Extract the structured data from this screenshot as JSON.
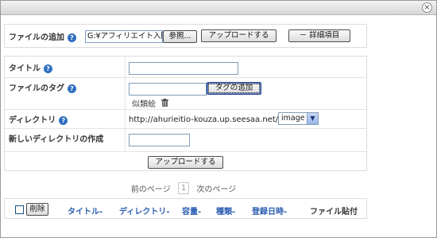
{
  "window": {
    "close_glyph": "×"
  },
  "upload_panel": {
    "label": "ファイルの追加",
    "file_path": "G:¥アフィリエイト入門¥",
    "browse_label": "参照...",
    "upload_label": "アップロードする",
    "details_label": "－ 詳細項目"
  },
  "details_panel": {
    "title_label": "タイトル",
    "title_value": "",
    "tag_label": "ファイルのタグ",
    "tag_value": "",
    "add_tag_label": "タグの追加",
    "similar_tags_label": "似類絵",
    "directory_label": "ディレクトリ",
    "directory_url": "http://ahurieitio-kouza.up.seesaa.net/",
    "directory_selected": "image",
    "new_dir_label": "新しいディレクトリの作成",
    "new_dir_value": "",
    "upload_label": "アップロードする"
  },
  "pager": {
    "prev": "前のページ",
    "current": "1",
    "next": "次のページ"
  },
  "table": {
    "delete_label": "削除",
    "columns": [
      {
        "label": "タイトル",
        "sort": "-"
      },
      {
        "label": "ディレクトリ",
        "sort": "-"
      },
      {
        "label": "容量",
        "sort": "-"
      },
      {
        "label": "種類",
        "sort": "-"
      },
      {
        "label": "登録日時",
        "sort": "-"
      },
      {
        "label": "ファイル貼付",
        "sort": ""
      }
    ]
  },
  "icons": {
    "help": "help-icon",
    "trash": "trash-icon",
    "close": "close-icon",
    "dropdown": "chevron-down-icon"
  },
  "colors": {
    "help_icon": "#2f6fc1",
    "sort_link": "#2a5db0"
  }
}
